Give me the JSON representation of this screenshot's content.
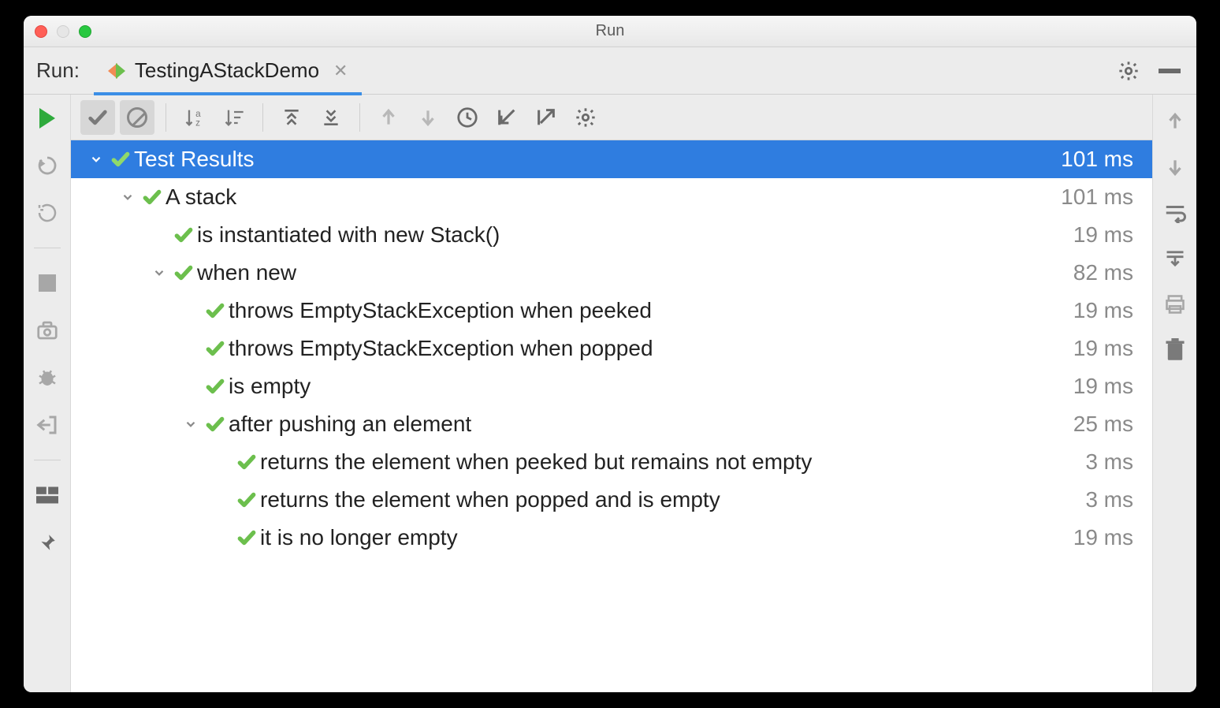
{
  "window": {
    "title": "Run"
  },
  "tabbar": {
    "label": "Run:",
    "run_config_name": "TestingAStackDemo"
  },
  "colors": {
    "pass": "#6cbf4d",
    "selection": "#2f7de0",
    "accent_tab": "#3b8ee6"
  },
  "tree": {
    "root": {
      "label": "Test Results",
      "time": "101 ms"
    },
    "nodes": [
      {
        "indent": 1,
        "expand": true,
        "label": "A stack",
        "time": "101 ms"
      },
      {
        "indent": 2,
        "expand": null,
        "label": "is instantiated with new Stack()",
        "time": "19 ms"
      },
      {
        "indent": 2,
        "expand": true,
        "label": "when new",
        "time": "82 ms"
      },
      {
        "indent": 3,
        "expand": null,
        "label": "throws EmptyStackException when peeked",
        "time": "19 ms"
      },
      {
        "indent": 3,
        "expand": null,
        "label": "throws EmptyStackException when popped",
        "time": "19 ms"
      },
      {
        "indent": 3,
        "expand": null,
        "label": "is empty",
        "time": "19 ms"
      },
      {
        "indent": 3,
        "expand": true,
        "label": "after pushing an element",
        "time": "25 ms"
      },
      {
        "indent": 4,
        "expand": null,
        "label": "returns the element when peeked but remains not empty",
        "time": "3 ms"
      },
      {
        "indent": 4,
        "expand": null,
        "label": "returns the element when popped and is empty",
        "time": "3 ms"
      },
      {
        "indent": 4,
        "expand": null,
        "label": "it is no longer empty",
        "time": "19 ms"
      }
    ]
  }
}
